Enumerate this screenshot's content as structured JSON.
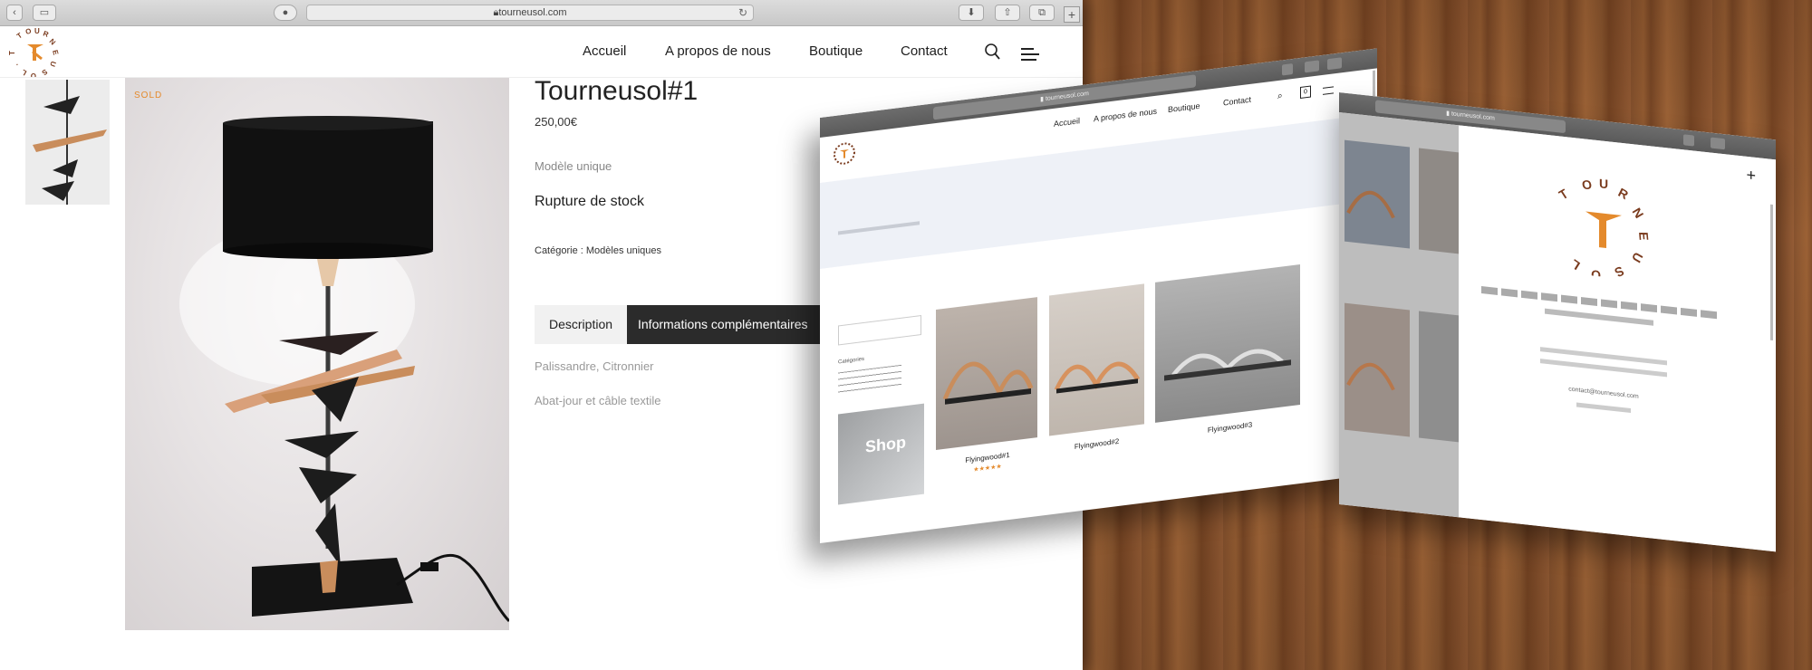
{
  "browser": {
    "url": "tourneusol.com"
  },
  "header": {
    "nav": [
      "Accueil",
      "A propos de nous",
      "Boutique",
      "Contact"
    ]
  },
  "product": {
    "badge": "SOLD",
    "title": "Tourneusol#1",
    "price": "250,00€",
    "subtitle": "Modèle unique",
    "stock": "Rupture de stock",
    "category": "Catégorie : Modèles uniques",
    "tabs": [
      "Description",
      "Informations complémentaires"
    ],
    "info": [
      "Palissandre, Citronnier",
      "Abat-jour et câble textile"
    ]
  },
  "screen2": {
    "nav": [
      "Accueil",
      "A propos de nous",
      "Boutique",
      "Contact"
    ],
    "cart_count": "0",
    "shop_label": "Shop",
    "sidebar_title": "Catégories",
    "products": [
      {
        "name": "Flyingwood#1",
        "stars": "★★★★★"
      },
      {
        "name": "Flyingwood#2",
        "stars": ""
      },
      {
        "name": "Flyingwood#3",
        "stars": ""
      }
    ]
  },
  "screen3": {
    "close": "+",
    "contact_email": "contact@tourneusol.com"
  },
  "colors": {
    "accent": "#e48a2c",
    "dark": "#2b2b2b",
    "band": "#eef1f7"
  }
}
